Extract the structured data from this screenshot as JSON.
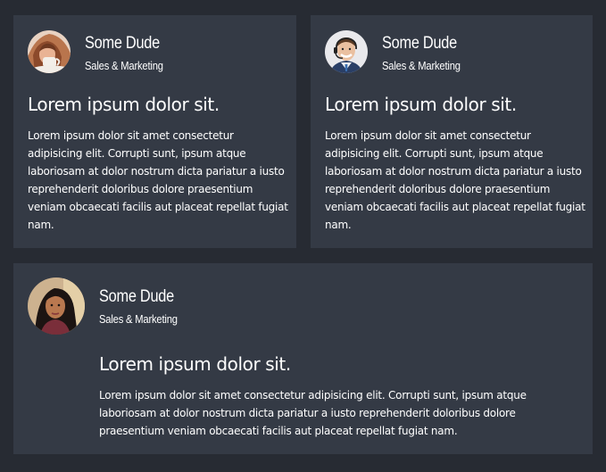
{
  "testimonials": [
    {
      "name": "Some Dude",
      "role": "Sales & Marketing",
      "headline": "Lorem ipsum dolor sit.",
      "body": "Lorem ipsum dolor sit amet consectetur adipisicing elit. Corrupti sunt, ipsum atque laboriosam at dolor nostrum dicta pariatur a iusto reprehenderit doloribus dolore praesentium veniam obcaecati facilis aut placeat repellat fugiat nam.",
      "avatar_icon": "woman-drinking-coffee-avatar"
    },
    {
      "name": "Some Dude",
      "role": "Sales & Marketing",
      "headline": "Lorem ipsum dolor sit.",
      "body": "Lorem ipsum dolor sit amet consectetur adipisicing elit. Corrupti sunt, ipsum atque laboriosam at dolor nostrum dicta pariatur a iusto reprehenderit doloribus dolore praesentium veniam obcaecati facilis aut placeat repellat fugiat nam.",
      "avatar_icon": "smiling-man-with-headset-avatar"
    },
    {
      "name": "Some Dude",
      "role": "Sales & Marketing",
      "headline": "Lorem ipsum dolor sit.",
      "body": "Lorem ipsum dolor sit amet consectetur adipisicing elit. Corrupti sunt, ipsum atque laboriosam at dolor nostrum dicta pariatur a iusto reprehenderit doloribus dolore praesentium veniam obcaecati facilis aut placeat repellat fugiat nam.",
      "avatar_icon": "woman-portrait-avatar"
    }
  ],
  "colors": {
    "page_background": "#272b33",
    "card_background": "#343a45",
    "text": "#ffffff"
  }
}
